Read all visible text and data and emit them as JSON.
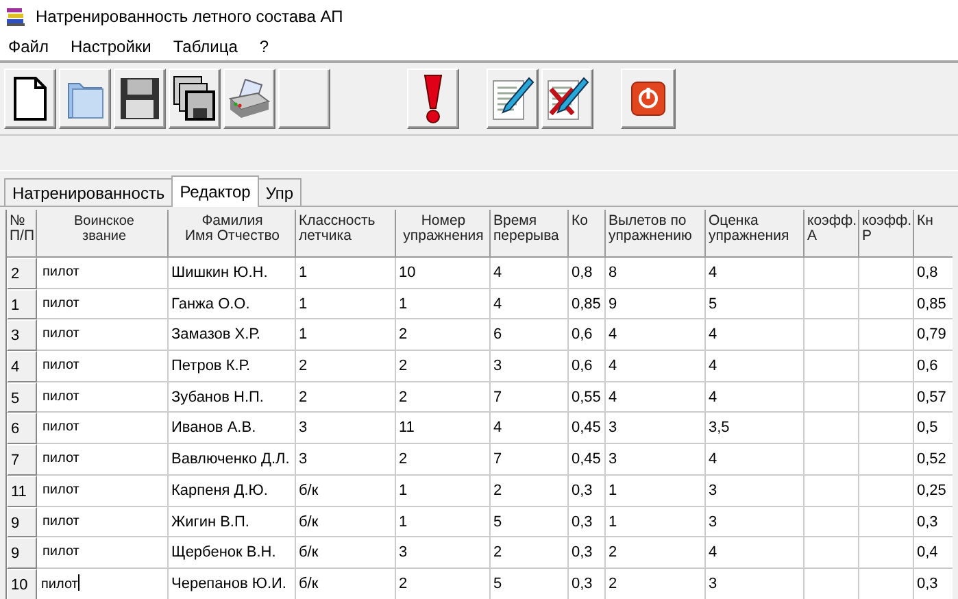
{
  "window": {
    "title": "Натренированность  летного состава АП"
  },
  "menu": [
    "Файл",
    "Настройки",
    "Таблица",
    "?"
  ],
  "toolbar": [
    {
      "kind": "new"
    },
    {
      "kind": "open"
    },
    {
      "kind": "save"
    },
    {
      "kind": "saveall"
    },
    {
      "kind": "print"
    },
    {
      "kind": "blank"
    },
    {
      "kind": "gap"
    },
    {
      "kind": "alert"
    },
    {
      "kind": "edit"
    },
    {
      "kind": "delete"
    },
    {
      "kind": "exit"
    }
  ],
  "tabs": [
    {
      "label": "Натренированность",
      "selected": false
    },
    {
      "label": "Редактор",
      "selected": true
    },
    {
      "label": "Упр",
      "selected": false
    }
  ],
  "table": {
    "columns": [
      "№\nП/П",
      "Воинское\nзвание",
      "Фамилия\nИмя Отчество",
      "Классность\nлетчика",
      "Номер\nупражнения",
      "Время\nперерыва",
      "Ко",
      "Вылетов по\nупражнению",
      "Оценка\nупражнения",
      "коэфф.\nА",
      "коэфф.\nР",
      "Кн"
    ],
    "rows": [
      {
        "cells": [
          "2",
          "пилот",
          "Шишкин Ю.Н.",
          "1",
          "10",
          "4",
          "0,8",
          "8",
          "4",
          "",
          "",
          "0,8"
        ],
        "editing": false
      },
      {
        "cells": [
          "1",
          "пилот",
          "Ганжа О.О.",
          "1",
          "1",
          "4",
          "0,85",
          "9",
          "5",
          "",
          "",
          "0,85"
        ],
        "editing": false
      },
      {
        "cells": [
          "3",
          "пилот",
          "Замазов Х.Р.",
          "1",
          "2",
          "6",
          "0,6",
          "4",
          "4",
          "",
          "",
          "0,79"
        ],
        "editing": false
      },
      {
        "cells": [
          "4",
          "пилот",
          "Петров К.Р.",
          "2",
          "2",
          "3",
          "0,6",
          "4",
          "4",
          "",
          "",
          "0,6"
        ],
        "editing": false
      },
      {
        "cells": [
          "5",
          "пилот",
          "Зубанов Н.П.",
          "2",
          "2",
          "7",
          "0,55",
          "4",
          "4",
          "",
          "",
          "0,57"
        ],
        "editing": false
      },
      {
        "cells": [
          "6",
          "пилот",
          "Иванов А.В.",
          "3",
          "11",
          "4",
          "0,45",
          "3",
          "3,5",
          "",
          "",
          "0,5"
        ],
        "editing": false
      },
      {
        "cells": [
          "7",
          "пилот",
          "Вавлюченко Д.Л.",
          "3",
          "2",
          "7",
          "0,45",
          "3",
          "4",
          "",
          "",
          "0,52"
        ],
        "editing": false
      },
      {
        "cells": [
          "11",
          "пилот",
          "Карпеня Д.Ю.",
          "б/к",
          "1",
          "2",
          "0,3",
          "1",
          "3",
          "",
          "",
          "0,25"
        ],
        "editing": false
      },
      {
        "cells": [
          "9",
          "пилот",
          "Жигин В.П.",
          "б/к",
          "1",
          "5",
          "0,3",
          "1",
          "3",
          "",
          "",
          "0,3"
        ],
        "editing": false
      },
      {
        "cells": [
          "9",
          "пилот",
          "Щербенок В.Н.",
          "б/к",
          "3",
          "2",
          "0,3",
          "2",
          "4",
          "",
          "",
          "0,4"
        ],
        "editing": false
      },
      {
        "cells": [
          "10",
          "пилот",
          "Черепанов Ю.И.",
          "б/к",
          "2",
          "5",
          "0,3",
          "2",
          "3",
          "",
          "",
          "0,3"
        ],
        "editing": true
      }
    ]
  }
}
